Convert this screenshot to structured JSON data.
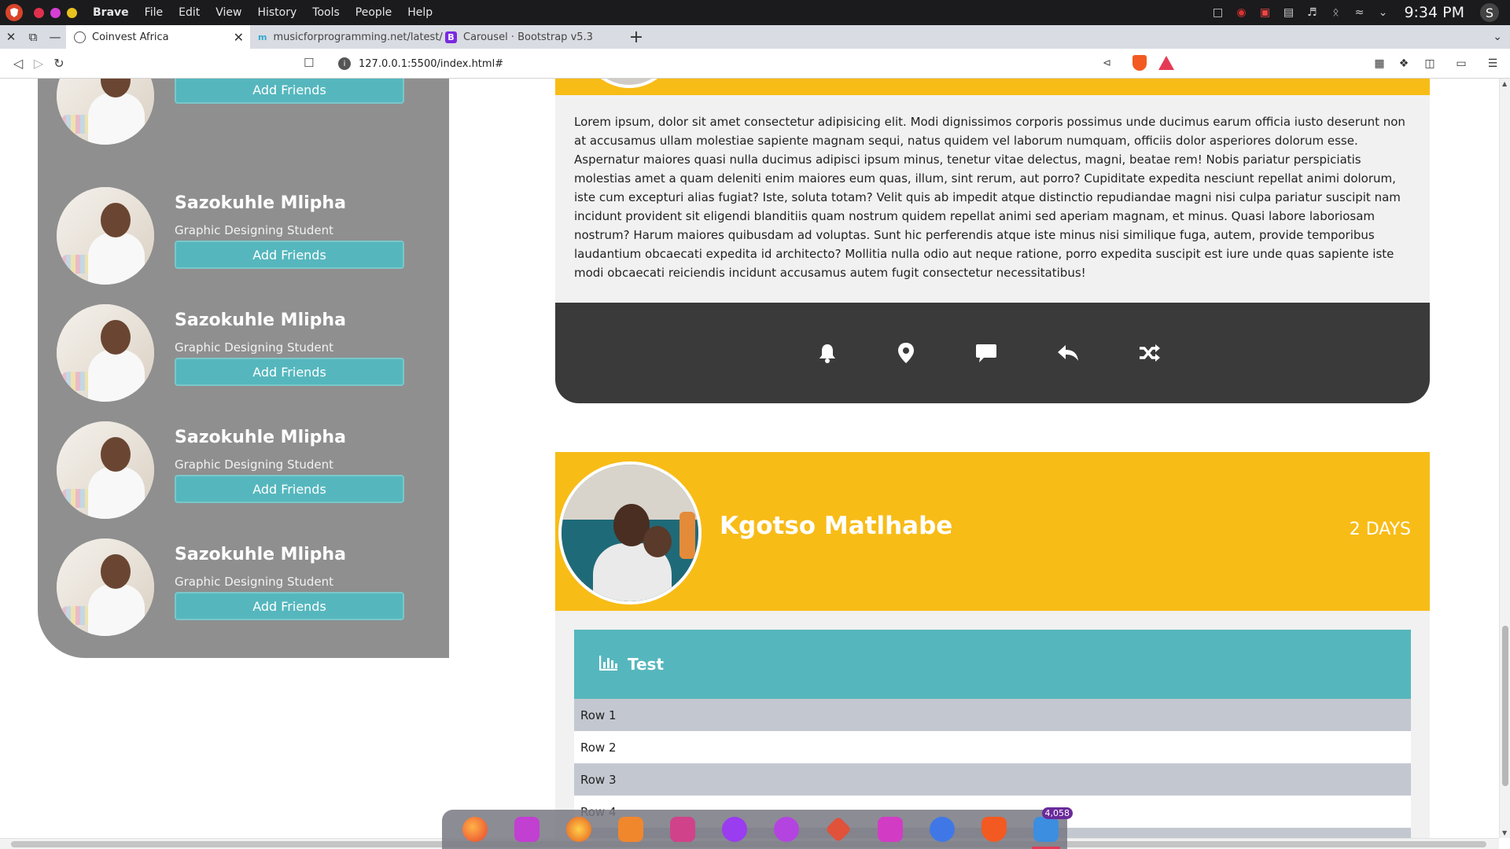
{
  "os": {
    "app_name": "Brave",
    "menu": [
      "File",
      "Edit",
      "View",
      "History",
      "Tools",
      "People",
      "Help"
    ],
    "clock": "9:34 PM",
    "user_initial": "S",
    "window_dot_colors": [
      "#e0304d",
      "#d63fd6",
      "#e8c21e"
    ]
  },
  "tabs": [
    {
      "title": "Coinvest Africa",
      "icon": "globe-icon",
      "active": true
    },
    {
      "title": "musicforprogramming.net/latest/",
      "icon": "m-icon",
      "favicon_text": "m",
      "active": false
    },
    {
      "title": "Carousel · Bootstrap v5.3",
      "icon": "bootstrap-icon",
      "favicon_text": "B",
      "active": false
    }
  ],
  "address": {
    "url": "127.0.0.1:5500/index.html#"
  },
  "friends": [
    {
      "name": "Sazokuhle Mlipha",
      "role": "Graphic Designing Student",
      "button": "Add Friends"
    },
    {
      "name": "Sazokuhle Mlipha",
      "role": "Graphic Designing Student",
      "button": "Add Friends"
    },
    {
      "name": "Sazokuhle Mlipha",
      "role": "Graphic Designing Student",
      "button": "Add Friends"
    },
    {
      "name": "Sazokuhle Mlipha",
      "role": "Graphic Designing Student",
      "button": "Add Friends"
    },
    {
      "name": "Sazokuhle Mlipha",
      "role": "Graphic Designing Student",
      "button": "Add Friends"
    }
  ],
  "post1": {
    "text": "Lorem ipsum, dolor sit amet consectetur adipisicing elit. Modi dignissimos corporis possimus unde ducimus earum officia iusto deserunt non at accusamus ullam molestiae sapiente magnam sequi, natus quidem vel laborum numquam, officiis dolor asperiores dolorum esse. Aspernatur maiores quasi nulla ducimus adipisci ipsum minus, tenetur vitae delectus, magni, beatae rem! Nobis pariatur perspiciatis molestias amet a quam deleniti enim maiores eum quas, illum, sint rerum, aut porro? Cupiditate expedita nesciunt repellat animi dolorum, iste cum excepturi alias fugiat? Iste, soluta totam? Velit quis ab impedit atque distinctio repudiandae magni nisi culpa pariatur suscipit nam incidunt provident sit eligendi blanditiis quam nostrum quidem repellat animi sed aperiam magnam, et minus. Quasi labore laboriosam nostrum? Harum maiores quibusdam ad voluptas. Sunt hic perferendis atque iste minus nisi similique fuga, autem, provide temporibus laudantium obcaecati expedita id architecto? Mollitia nulla odio aut neque ratione, porro expedita suscipit est iure unde quas sapiente iste modi obcaecati reiciendis incidunt accusamus autem fugit consectetur necessitatibus!",
    "actions": [
      "bell-icon",
      "location-pin-icon",
      "comment-icon",
      "reply-icon",
      "shuffle-icon"
    ]
  },
  "post2": {
    "name": "Kgotso Matlhabe",
    "time": "2 DAYS",
    "card_title": "Test",
    "rows": [
      "Row 1",
      "Row 2",
      "Row 3",
      "Row 4"
    ]
  },
  "dock": {
    "apps": [
      "firefox-icon",
      "terminal-icon",
      "browser-icon",
      "files-icon",
      "settings-sliders-icon",
      "s-app-icon",
      "gear-icon",
      "git-icon",
      "store-icon",
      "mail-icon",
      "brave-icon",
      "vscode-icon"
    ],
    "badge": "4,058"
  },
  "colors": {
    "accent_yellow": "#f8bc17",
    "teal": "#55b7bd",
    "panel_gray": "#8f8f8f",
    "dark_bar": "#3a3a3a"
  }
}
